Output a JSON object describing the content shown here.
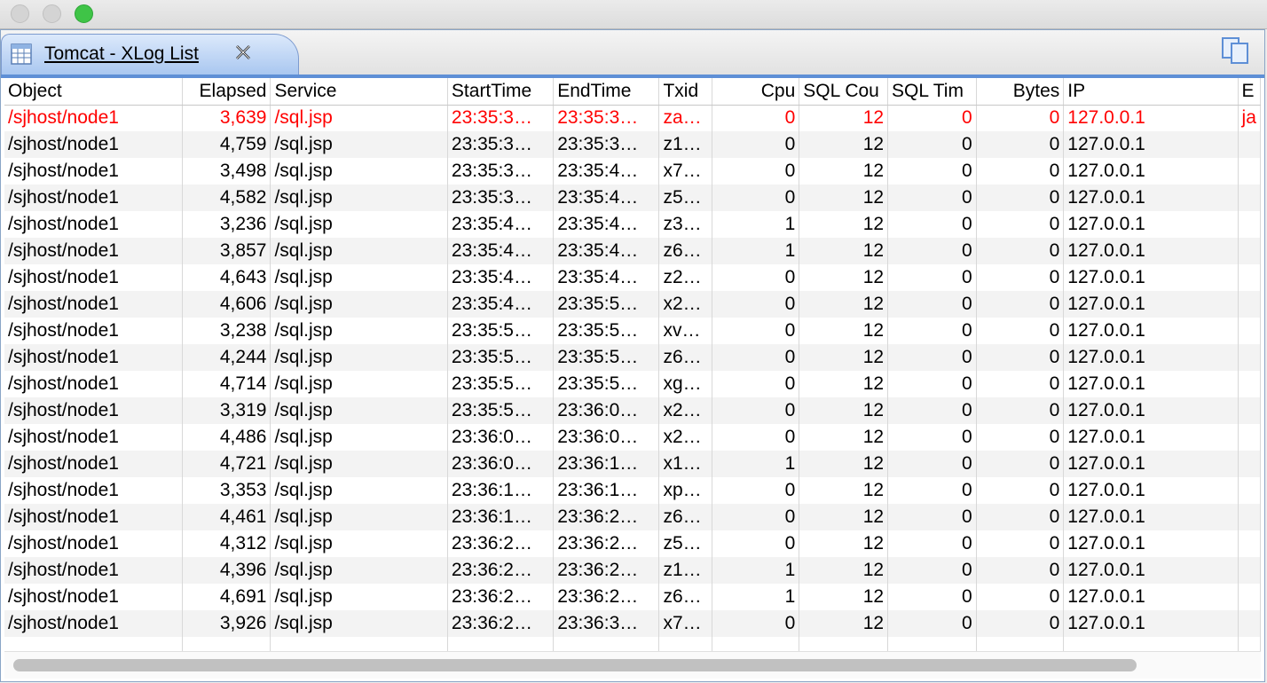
{
  "window": {
    "tab_title": "Tomcat - XLog List",
    "icons": {
      "tab": "table-icon",
      "close": "close-icon",
      "copy": "copy-icon"
    }
  },
  "table": {
    "columns": [
      "Object",
      "Elapsed",
      "Service",
      "StartTime",
      "EndTime",
      "Txid",
      "Cpu",
      "SQL Cou",
      "SQL Tim",
      "Bytes",
      "IP",
      "E"
    ],
    "rows": [
      {
        "object": "/sjhost/node1",
        "elapsed": "3,639",
        "service": "/sql.jsp",
        "start": "23:35:3…",
        "end": "23:35:3…",
        "txid": "za…",
        "cpu": "0",
        "sql_count": "12",
        "sql_time": "0",
        "bytes": "0",
        "ip": "127.0.0.1",
        "extra": "ja",
        "error": true
      },
      {
        "object": "/sjhost/node1",
        "elapsed": "4,759",
        "service": "/sql.jsp",
        "start": "23:35:3…",
        "end": "23:35:3…",
        "txid": "z1…",
        "cpu": "0",
        "sql_count": "12",
        "sql_time": "0",
        "bytes": "0",
        "ip": "127.0.0.1",
        "extra": "",
        "error": false
      },
      {
        "object": "/sjhost/node1",
        "elapsed": "3,498",
        "service": "/sql.jsp",
        "start": "23:35:3…",
        "end": "23:35:4…",
        "txid": "x7…",
        "cpu": "0",
        "sql_count": "12",
        "sql_time": "0",
        "bytes": "0",
        "ip": "127.0.0.1",
        "extra": "",
        "error": false
      },
      {
        "object": "/sjhost/node1",
        "elapsed": "4,582",
        "service": "/sql.jsp",
        "start": "23:35:3…",
        "end": "23:35:4…",
        "txid": "z5…",
        "cpu": "0",
        "sql_count": "12",
        "sql_time": "0",
        "bytes": "0",
        "ip": "127.0.0.1",
        "extra": "",
        "error": false
      },
      {
        "object": "/sjhost/node1",
        "elapsed": "3,236",
        "service": "/sql.jsp",
        "start": "23:35:4…",
        "end": "23:35:4…",
        "txid": "z3…",
        "cpu": "1",
        "sql_count": "12",
        "sql_time": "0",
        "bytes": "0",
        "ip": "127.0.0.1",
        "extra": "",
        "error": false
      },
      {
        "object": "/sjhost/node1",
        "elapsed": "3,857",
        "service": "/sql.jsp",
        "start": "23:35:4…",
        "end": "23:35:4…",
        "txid": "z6…",
        "cpu": "1",
        "sql_count": "12",
        "sql_time": "0",
        "bytes": "0",
        "ip": "127.0.0.1",
        "extra": "",
        "error": false
      },
      {
        "object": "/sjhost/node1",
        "elapsed": "4,643",
        "service": "/sql.jsp",
        "start": "23:35:4…",
        "end": "23:35:4…",
        "txid": "z2…",
        "cpu": "0",
        "sql_count": "12",
        "sql_time": "0",
        "bytes": "0",
        "ip": "127.0.0.1",
        "extra": "",
        "error": false
      },
      {
        "object": "/sjhost/node1",
        "elapsed": "4,606",
        "service": "/sql.jsp",
        "start": "23:35:4…",
        "end": "23:35:5…",
        "txid": "x2…",
        "cpu": "0",
        "sql_count": "12",
        "sql_time": "0",
        "bytes": "0",
        "ip": "127.0.0.1",
        "extra": "",
        "error": false
      },
      {
        "object": "/sjhost/node1",
        "elapsed": "3,238",
        "service": "/sql.jsp",
        "start": "23:35:5…",
        "end": "23:35:5…",
        "txid": "xv…",
        "cpu": "0",
        "sql_count": "12",
        "sql_time": "0",
        "bytes": "0",
        "ip": "127.0.0.1",
        "extra": "",
        "error": false
      },
      {
        "object": "/sjhost/node1",
        "elapsed": "4,244",
        "service": "/sql.jsp",
        "start": "23:35:5…",
        "end": "23:35:5…",
        "txid": "z6…",
        "cpu": "0",
        "sql_count": "12",
        "sql_time": "0",
        "bytes": "0",
        "ip": "127.0.0.1",
        "extra": "",
        "error": false
      },
      {
        "object": "/sjhost/node1",
        "elapsed": "4,714",
        "service": "/sql.jsp",
        "start": "23:35:5…",
        "end": "23:35:5…",
        "txid": "xg…",
        "cpu": "0",
        "sql_count": "12",
        "sql_time": "0",
        "bytes": "0",
        "ip": "127.0.0.1",
        "extra": "",
        "error": false
      },
      {
        "object": "/sjhost/node1",
        "elapsed": "3,319",
        "service": "/sql.jsp",
        "start": "23:35:5…",
        "end": "23:36:0…",
        "txid": "x2…",
        "cpu": "0",
        "sql_count": "12",
        "sql_time": "0",
        "bytes": "0",
        "ip": "127.0.0.1",
        "extra": "",
        "error": false
      },
      {
        "object": "/sjhost/node1",
        "elapsed": "4,486",
        "service": "/sql.jsp",
        "start": "23:36:0…",
        "end": "23:36:0…",
        "txid": "x2…",
        "cpu": "0",
        "sql_count": "12",
        "sql_time": "0",
        "bytes": "0",
        "ip": "127.0.0.1",
        "extra": "",
        "error": false
      },
      {
        "object": "/sjhost/node1",
        "elapsed": "4,721",
        "service": "/sql.jsp",
        "start": "23:36:0…",
        "end": "23:36:1…",
        "txid": "x1…",
        "cpu": "1",
        "sql_count": "12",
        "sql_time": "0",
        "bytes": "0",
        "ip": "127.0.0.1",
        "extra": "",
        "error": false
      },
      {
        "object": "/sjhost/node1",
        "elapsed": "3,353",
        "service": "/sql.jsp",
        "start": "23:36:1…",
        "end": "23:36:1…",
        "txid": "xp…",
        "cpu": "0",
        "sql_count": "12",
        "sql_time": "0",
        "bytes": "0",
        "ip": "127.0.0.1",
        "extra": "",
        "error": false
      },
      {
        "object": "/sjhost/node1",
        "elapsed": "4,461",
        "service": "/sql.jsp",
        "start": "23:36:1…",
        "end": "23:36:2…",
        "txid": "z6…",
        "cpu": "0",
        "sql_count": "12",
        "sql_time": "0",
        "bytes": "0",
        "ip": "127.0.0.1",
        "extra": "",
        "error": false
      },
      {
        "object": "/sjhost/node1",
        "elapsed": "4,312",
        "service": "/sql.jsp",
        "start": "23:36:2…",
        "end": "23:36:2…",
        "txid": "z5…",
        "cpu": "0",
        "sql_count": "12",
        "sql_time": "0",
        "bytes": "0",
        "ip": "127.0.0.1",
        "extra": "",
        "error": false
      },
      {
        "object": "/sjhost/node1",
        "elapsed": "4,396",
        "service": "/sql.jsp",
        "start": "23:36:2…",
        "end": "23:36:2…",
        "txid": "z1…",
        "cpu": "1",
        "sql_count": "12",
        "sql_time": "0",
        "bytes": "0",
        "ip": "127.0.0.1",
        "extra": "",
        "error": false
      },
      {
        "object": "/sjhost/node1",
        "elapsed": "4,691",
        "service": "/sql.jsp",
        "start": "23:36:2…",
        "end": "23:36:2…",
        "txid": "z6…",
        "cpu": "1",
        "sql_count": "12",
        "sql_time": "0",
        "bytes": "0",
        "ip": "127.0.0.1",
        "extra": "",
        "error": false
      },
      {
        "object": "/sjhost/node1",
        "elapsed": "3,926",
        "service": "/sql.jsp",
        "start": "23:36:2…",
        "end": "23:36:3…",
        "txid": "x7…",
        "cpu": "0",
        "sql_count": "12",
        "sql_time": "0",
        "bytes": "0",
        "ip": "127.0.0.1",
        "extra": "",
        "error": false
      }
    ]
  },
  "colors": {
    "error_text": "#ff0000",
    "tab_accent": "#5e8fd6"
  }
}
